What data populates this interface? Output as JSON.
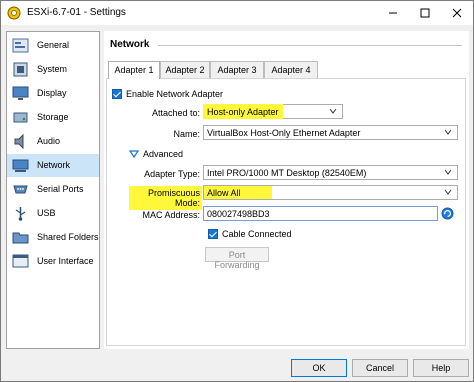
{
  "window": {
    "title": "ESXi-6.7-01 - Settings"
  },
  "sidebar": {
    "items": [
      {
        "label": "General",
        "icon": "general-icon"
      },
      {
        "label": "System",
        "icon": "chip-icon"
      },
      {
        "label": "Display",
        "icon": "monitor-icon"
      },
      {
        "label": "Storage",
        "icon": "disk-icon"
      },
      {
        "label": "Audio",
        "icon": "speaker-icon"
      },
      {
        "label": "Network",
        "icon": "network-icon"
      },
      {
        "label": "Serial Ports",
        "icon": "serial-port-icon"
      },
      {
        "label": "USB",
        "icon": "usb-icon"
      },
      {
        "label": "Shared Folders",
        "icon": "folder-icon"
      },
      {
        "label": "User Interface",
        "icon": "ui-icon"
      }
    ],
    "selected": "Network"
  },
  "main": {
    "title": "Network",
    "tabs": [
      "Adapter 1",
      "Adapter 2",
      "Adapter 3",
      "Adapter 4"
    ],
    "active_tab": "Adapter 1",
    "enable_adapter": {
      "label": "Enable Network Adapter",
      "checked": true
    },
    "attached_to": {
      "label": "Attached to:",
      "value": "Host-only Adapter"
    },
    "name": {
      "label": "Name:",
      "value": "VirtualBox Host-Only Ethernet Adapter"
    },
    "advanced": {
      "label": "Advanced",
      "expanded": true
    },
    "adapter_type": {
      "label": "Adapter Type:",
      "value": "Intel PRO/1000 MT Desktop (82540EM)"
    },
    "promiscuous_mode": {
      "label": "Promiscuous Mode:",
      "value": "Allow All"
    },
    "mac_address": {
      "label": "MAC Address:",
      "value": "080027498BD3"
    },
    "cable_connected": {
      "label": "Cable Connected",
      "checked": true
    },
    "port_forwarding": {
      "label": "Port Forwarding"
    },
    "highlight_color": "#fff83a",
    "accent_color": "#1976d2"
  },
  "footer": {
    "ok_label": "OK",
    "cancel_label": "Cancel",
    "help_label": "Help"
  }
}
